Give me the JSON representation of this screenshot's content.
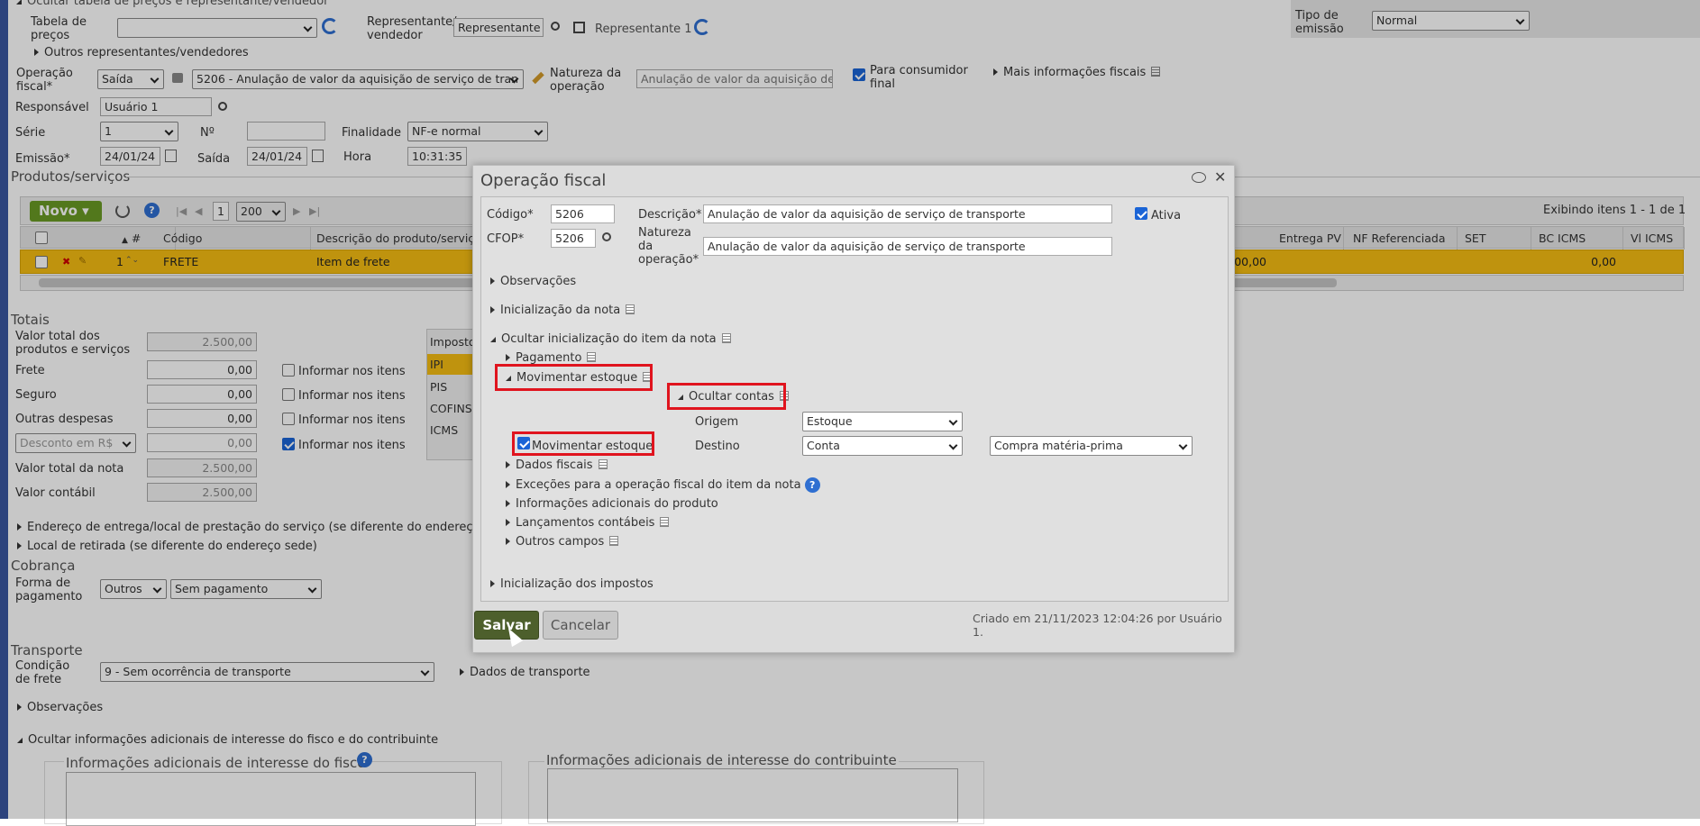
{
  "top": {
    "hide_price_table": "Ocultar tabela de preços e representante/vendedor",
    "price_table_label": "Tabela de preços",
    "price_table_value": "",
    "representative_label": "Representante/ vendedor",
    "representative_value": "Representante 1",
    "representative_link": "Representante 1",
    "other_reps": "Outros representantes/vendedores",
    "emission_type_label": "Tipo de emissão",
    "emission_type_value": "Normal"
  },
  "form": {
    "operacao_label": "Operação fiscal*",
    "operacao_tipo": "Saída",
    "operacao_value": "5206 - Anulação de valor da aquisição de serviço de tran",
    "natureza_label": "Natureza da operação",
    "natureza_value": "Anulação de valor da aquisição de s",
    "consumidor_label": "Para consumidor final",
    "mais_info": "Mais informações fiscais",
    "responsavel_label": "Responsável",
    "responsavel_value": "Usuário 1",
    "serie_label": "Série",
    "serie_value": "1",
    "numero_label": "Nº",
    "numero_value": "",
    "finalidade_label": "Finalidade",
    "finalidade_value": "NF-e normal",
    "emissao_label": "Emissão*",
    "emissao_value": "24/01/24",
    "saida_label": "Saída",
    "saida_value": "24/01/24",
    "hora_label": "Hora",
    "hora_value": "10:31:35"
  },
  "produtos": {
    "title": "Produtos/serviços",
    "novo": "Novo",
    "page": "1",
    "page_size": "200",
    "exibindo": "Exibindo itens 1 - 1 de 1",
    "headers": [
      "#",
      "Código",
      "Descrição do produto/serviço",
      "Entrega PV",
      "NF Referenciada",
      "SET",
      "BC ICMS",
      "Vl ICMS"
    ],
    "row": {
      "num": "1",
      "codigo": "FRETE",
      "descricao": "Item de frete",
      "valor_parcial": "500,00",
      "bc_icms": "0,00"
    }
  },
  "totais": {
    "title": "Totais",
    "rows": [
      {
        "label": "Valor total dos produtos e serviços",
        "value": "2.500,00"
      },
      {
        "label": "Frete",
        "value": "0,00"
      },
      {
        "label": "Seguro",
        "value": "0,00"
      },
      {
        "label": "Outras despesas",
        "value": "0,00"
      },
      {
        "label": "Desconto em R$",
        "value": "0,00"
      },
      {
        "label": "Valor total da nota",
        "value": "2.500,00"
      },
      {
        "label": "Valor contábil",
        "value": "2.500,00"
      }
    ],
    "informar": "Informar nos itens",
    "impostos_header": "Impostos",
    "impostos": [
      "IPI",
      "PIS",
      "COFINS",
      "ICMS"
    ]
  },
  "lower": {
    "endereco_entrega": "Endereço de entrega/local de prestação do serviço (se diferente do endereço sede)",
    "local_retirada": "Local de retirada (se diferente do endereço sede)",
    "cobranca_title": "Cobrança",
    "forma_pagamento_label": "Forma de pagamento",
    "forma_pagamento_value": "Outros",
    "pagamento_value": "Sem pagamento",
    "transporte_title": "Transporte",
    "condicao_frete_label": "Condição de frete",
    "condicao_frete_value": "9 - Sem ocorrência de transporte",
    "dados_transporte": "Dados de transporte",
    "observacoes": "Observações",
    "ocultar_info_adic": "Ocultar informações adicionais de interesse do fisco e do contribuinte",
    "info_fisco": "Informações adicionais de interesse do fisco",
    "info_contribuinte": "Informações adicionais de interesse do contribuinte"
  },
  "dialog": {
    "title": "Operação fiscal",
    "codigo_label": "Código*",
    "codigo_value": "5206",
    "descricao_label": "Descrição*",
    "descricao_value": "Anulação de valor da aquisição de serviço de transporte",
    "ativa_label": "Ativa",
    "cfop_label": "CFOP*",
    "cfop_value": "5206",
    "natureza_label": "Natureza da operação*",
    "natureza_value": "Anulação de valor da aquisição de serviço de transporte",
    "observacoes": "Observações",
    "inicializacao_nota": "Inicialização da nota",
    "ocultar_inicializacao_item": "Ocultar inicialização do item da nota",
    "pagamento": "Pagamento",
    "movimentar_estoque_section": "Movimentar estoque",
    "ocultar_contas": "Ocultar contas",
    "origem_label": "Origem",
    "origem_value": "Estoque",
    "destino_label": "Destino",
    "destino_value": "Conta",
    "destino_conta_value": "Compra matéria-prima",
    "movimentar_estoque_check": "Movimentar estoque",
    "dados_fiscais": "Dados fiscais",
    "excecoes": "Exceções para a operação fiscal do item da nota",
    "info_adicionais_produto": "Informações adicionais do produto",
    "lancamentos": "Lançamentos contábeis",
    "outros_campos": "Outros campos",
    "inicializacao_impostos": "Inicialização dos impostos",
    "salvar": "Salvar",
    "cancelar": "Cancelar",
    "criado_em": "Criado em 21/11/2023 12:04:26 por Usuário 1."
  }
}
